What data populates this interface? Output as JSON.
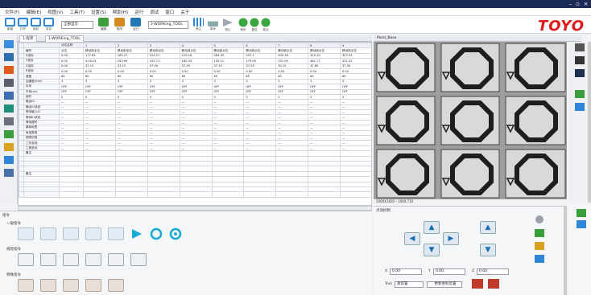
{
  "window": {
    "title_controls": {
      "min": "–",
      "max": "▫",
      "close": "×"
    },
    "menu": [
      "文件(F)",
      "编辑(E)",
      "视图(V)",
      "工具(T)",
      "设置(S)",
      "帮助(H)",
      "运行",
      "调试",
      "窗口",
      "关于"
    ]
  },
  "toolbar": {
    "items": [
      {
        "label": "新建",
        "color": "#2e86d6"
      },
      {
        "label": "打开",
        "color": "#2e86d6"
      },
      {
        "label": "保存",
        "color": "#2e86d6"
      },
      {
        "label": "另存",
        "color": "#2e86d6"
      },
      {
        "label": "编辑",
        "color": "#3a9e3a"
      },
      {
        "label": "程序",
        "color": "#d68a1f"
      },
      {
        "label": "运行",
        "color": "#1f78b4"
      },
      {
        "label": "停止",
        "color": "#9aa1aa"
      },
      {
        "label": "单步",
        "color": "#3aa640"
      },
      {
        "label": "复位",
        "color": "#3aa640"
      },
      {
        "label": "原点",
        "color": "#3aa640"
      }
    ],
    "combo1": "全部显示",
    "combo2": "2-WORKing_TOOL",
    "logo": "TOYO"
  },
  "tabs": {
    "tab1": "1-程序",
    "tab2": "1-WORKing_TOOL"
  },
  "grid": {
    "headers": [
      "",
      "",
      "点位名称",
      "1",
      "2",
      "3",
      "4",
      "5",
      "6",
      "7",
      "8",
      "9"
    ],
    "rows": [
      [
        "",
        "编号",
        "点位",
        "移动到点位",
        "移动到点位",
        "移动到点位",
        "移动到点位",
        "移动到点位",
        "移动到点位",
        "移动到点位",
        "移动到点位",
        "移动到点位"
      ],
      [
        "",
        "X坐标",
        "0.00",
        "177.63",
        "185.27",
        "224.27",
        "210.16",
        "284.35",
        "297.1",
        "300.18",
        "320.10",
        "357.93"
      ],
      [
        "",
        "Y坐标",
        "0.00",
        "0.00-01",
        "250.99",
        "105.71",
        "180.33",
        "105.11",
        "179.05",
        "191.05",
        "481.77",
        "321.02"
      ],
      [
        "",
        "Z坐标",
        "0.00",
        "37.15",
        "37.15",
        "97.09",
        "37.59",
        "37.15",
        "37.23",
        "30.15",
        "37.85",
        "37.35"
      ],
      [
        "",
        "R坐标",
        "0.00",
        "0.00",
        "0.00",
        "0.00",
        "0.00",
        "0.00",
        "0.00",
        "0.00",
        "0.00",
        "0.00"
      ],
      [
        "",
        "速度",
        "80",
        "80",
        "80",
        "80",
        "80",
        "80",
        "80",
        "80",
        "80",
        "80"
      ],
      [
        "",
        "加速度(mm)",
        "3",
        "3",
        "3",
        "3",
        "3",
        "3",
        "3",
        "3",
        "3",
        "3"
      ],
      [
        "",
        "手系",
        "OFF",
        "OFF",
        "OFF",
        "OFF",
        "OFF",
        "OFF",
        "OFF",
        "OFF",
        "OFF",
        "OFF"
      ],
      [
        "",
        "平系(on)",
        "OFF",
        "OFF",
        "OFF",
        "OFF",
        "OFF",
        "OFF",
        "OFF",
        "OFF",
        "OFF",
        "OFF"
      ],
      [
        "",
        "延时",
        "0",
        "0",
        "0",
        "0",
        "0",
        "0",
        "0",
        "0",
        "0",
        "0"
      ],
      [
        "",
        "输出IO",
        "—",
        "—",
        "—",
        "—",
        "—",
        "—",
        "—",
        "—",
        "—",
        "—"
      ],
      [
        "",
        "输出IO状态",
        "—",
        "—",
        "—",
        "—",
        "—",
        "—",
        "—",
        "—",
        "—",
        "—"
      ],
      [
        "",
        "等待输入IO",
        "—",
        "—",
        "—",
        "—",
        "—",
        "—",
        "—",
        "—",
        "—",
        "—"
      ],
      [
        "",
        "等待IO状态",
        "—",
        "—",
        "—",
        "—",
        "—",
        "—",
        "—",
        "—",
        "—",
        "—"
      ],
      [
        "",
        "等待超时",
        "—",
        "—",
        "—",
        "—",
        "—",
        "—",
        "—",
        "—",
        "—",
        "—"
      ],
      [
        "",
        "跳转标签",
        "—",
        "—",
        "—",
        "—",
        "—",
        "—",
        "—",
        "—",
        "—",
        "—"
      ],
      [
        "",
        "轨迹类型",
        "—",
        "—",
        "—",
        "—",
        "—",
        "—",
        "—",
        "—",
        "—",
        "—"
      ],
      [
        "",
        "视觉识别",
        "—",
        "—",
        "—",
        "—",
        "—",
        "—",
        "—",
        "—",
        "—",
        "—"
      ],
      [
        "",
        "工件坐标",
        "—",
        "—",
        "—",
        "—",
        "—",
        "—",
        "—",
        "—",
        "—",
        "—"
      ],
      [
        "",
        "工具坐标",
        "—",
        "—",
        "—",
        "—",
        "—",
        "—",
        "—",
        "—",
        "—",
        "—"
      ],
      [
        "",
        "备注",
        "",
        "",
        "",
        "",
        "",
        "",
        "",
        "",
        "",
        ""
      ],
      [
        "",
        "",
        "",
        "",
        "",
        "",
        "",
        "",
        "",
        "",
        "",
        ""
      ],
      [
        "",
        "",
        "",
        "",
        "",
        "",
        "",
        "",
        "",
        "",
        "",
        ""
      ],
      [
        "",
        "",
        "",
        "",
        "",
        "",
        "",
        "",
        "",
        "",
        "",
        ""
      ],
      [
        "",
        "备注",
        "",
        "",
        "",
        "",
        "",
        "",
        "",
        "",
        "",
        ""
      ],
      [
        "",
        "",
        "",
        "",
        "",
        "",
        "",
        "",
        "",
        "",
        "",
        ""
      ],
      [
        "",
        "",
        "",
        "",
        "",
        "",
        "",
        "",
        "",
        "",
        "",
        ""
      ],
      [
        "",
        "",
        "",
        "",
        "",
        "",
        "",
        "",
        "",
        "",
        "",
        ""
      ],
      [
        "",
        "",
        "",
        "",
        "",
        "",
        "",
        "",
        "",
        "",
        "",
        ""
      ]
    ]
  },
  "camera": {
    "title": "Point_Base",
    "footer": "2060X1600 - 1000,710"
  },
  "bottom": {
    "section_title": "指令",
    "group1": "一般指令",
    "group2": "视觉指令",
    "group3": "特殊指令"
  },
  "controls": {
    "title": "点动控制",
    "x_label": "X",
    "x_value": "0.00",
    "y_label": "Y",
    "y_value": "0.00",
    "z_label": "Z",
    "z_value": "0.00",
    "tool_label": "Tool",
    "tool_combo": "总装置",
    "tool_btn": "更新坐标位置"
  }
}
